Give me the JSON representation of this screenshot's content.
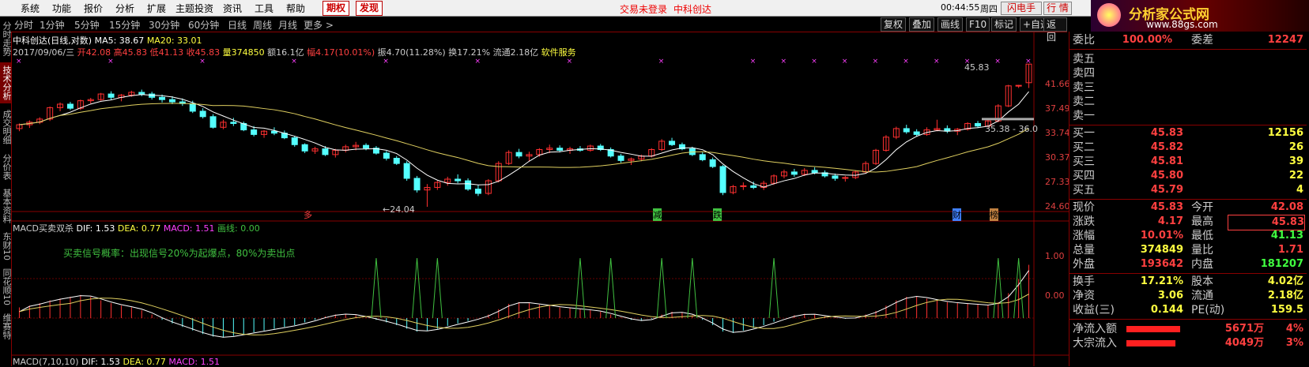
{
  "menu": [
    "系统",
    "功能",
    "报价",
    "分析",
    "扩展",
    "主题投资",
    "资讯",
    "工具",
    "帮助"
  ],
  "menu_red": [
    "期权",
    "发现"
  ],
  "status_login": "交易未登录",
  "status_stock": "中科创达",
  "clock": "00:44:55",
  "weekday": "周四",
  "btn_flash": "闪电手",
  "btn_quote": "行 情",
  "win_btns": [
    "-",
    "□",
    "×"
  ],
  "tabs": [
    "分时",
    "1分钟",
    "5分钟",
    "15分钟",
    "30分钟",
    "60分钟",
    "日线",
    "周线",
    "月线",
    "更多 >"
  ],
  "right_tabs": [
    "复权",
    "叠加",
    "画线",
    "F10",
    "标记",
    "+自选",
    "返回"
  ],
  "side_tabs": [
    "分时走势",
    "技术分析",
    "成交明细",
    "分价表",
    "基本资料",
    "东财10",
    "同花顺10",
    "维赛特"
  ],
  "logo": {
    "title": "分析家公式网",
    "url": "www.88gs.com"
  },
  "chart_info": {
    "name": "中科创达(日线,对数)",
    "ma5": "MA5: 38.67",
    "ma20": "MA20: 33.01"
  },
  "date_line": {
    "date": "2017/09/06/三",
    "open": "开42.08",
    "high": "高45.83",
    "low": "低41.13",
    "close": "收45.83",
    "vol": "量374850",
    "amt": "额16.1亿",
    "chg": "幅4.17(10.01%)",
    "amp": "振4.70(11.28%)",
    "turn": "换17.21%",
    "float": "流通2.18亿",
    "sector": "软件服务"
  },
  "macd_line": {
    "name": "MACD买卖双杀",
    "dif": "DIF: 1.53",
    "dea": "DEA: 0.77",
    "macd": "MACD: 1.51",
    "draw": "画线: 0.00"
  },
  "macd_note": "买卖信号概率：出现信号20%为起爆点，80%为卖出点",
  "macd2_line": {
    "name": "MACD(7,10,10)",
    "dif": "DIF: 1.53",
    "dea": "DEA: 0.77",
    "macd": "MACD: 1.51"
  },
  "price_labels": {
    "hi": "45.83",
    "lo": "←24.04",
    "mid": "35.38 - 36.0"
  },
  "markers": [
    "多",
    "减",
    "跌",
    "财",
    "榜"
  ],
  "y_ticks": [
    "41.66",
    "37.49",
    "33.74",
    "30.37",
    "27.33",
    "24.60"
  ],
  "macd_ticks": [
    "1.00",
    "0.00"
  ],
  "rp_top": {
    "label": "委比",
    "value": "100.00%",
    "label2": "委差",
    "value2": "12247"
  },
  "asks": [
    "卖五",
    "卖四",
    "卖三",
    "卖二",
    "卖一"
  ],
  "bids": [
    {
      "label": "买一",
      "price": "45.83",
      "vol": "12156"
    },
    {
      "label": "买二",
      "price": "45.82",
      "vol": "26"
    },
    {
      "label": "买三",
      "price": "45.81",
      "vol": "39"
    },
    {
      "label": "买四",
      "price": "45.80",
      "vol": "22"
    },
    {
      "label": "买五",
      "price": "45.79",
      "vol": "4"
    }
  ],
  "stats": [
    {
      "l": "现价",
      "v": "45.83",
      "l2": "今开",
      "v2": "42.08",
      "c": "#ff4040",
      "c2": "#ff4040"
    },
    {
      "l": "涨跌",
      "v": "4.17",
      "l2": "最高",
      "v2": "45.83",
      "c": "#ff4040",
      "c2": "#ff4040"
    },
    {
      "l": "涨幅",
      "v": "10.01%",
      "l2": "最低",
      "v2": "41.13",
      "c": "#ff4040",
      "c2": "#40ff40"
    },
    {
      "l": "总量",
      "v": "374849",
      "l2": "量比",
      "v2": "1.71",
      "c": "#ffff40",
      "c2": "#ff4040"
    },
    {
      "l": "外盘",
      "v": "193642",
      "l2": "内盘",
      "v2": "181207",
      "c": "#ff4040",
      "c2": "#40ff40"
    }
  ],
  "stats2": [
    {
      "l": "换手",
      "v": "17.21%",
      "l2": "股本",
      "v2": "4.02亿"
    },
    {
      "l": "净资",
      "v": "3.06",
      "l2": "流通",
      "v2": "2.18亿"
    },
    {
      "l": "收益(三)",
      "v": "0.144",
      "l2": "PE(动)",
      "v2": "159.5"
    }
  ],
  "flows": [
    {
      "l": "净流入额",
      "v": "5671万",
      "p": "4%"
    },
    {
      "l": "大宗流入",
      "v": "4049万",
      "p": "3%"
    }
  ],
  "colors": {
    "up": "#ff3030",
    "down": "#54ffff",
    "ma5": "#ffffff",
    "ma20": "#e0d060",
    "signal": "#40c040"
  },
  "chart_data": [
    {
      "type": "candlestick",
      "title": "中科创达(日线,对数)",
      "ohlc_approx": [
        [
          34.2,
          35.0,
          33.8,
          34.8
        ],
        [
          34.8,
          35.5,
          34.3,
          35.2
        ],
        [
          35.2,
          36.0,
          34.9,
          35.7
        ],
        [
          35.7,
          37.8,
          35.4,
          37.6
        ],
        [
          37.6,
          38.5,
          37.0,
          38.2
        ],
        [
          38.2,
          38.6,
          37.2,
          37.5
        ],
        [
          37.5,
          39.0,
          37.2,
          38.8
        ],
        [
          38.8,
          39.3,
          38.3,
          39.0
        ],
        [
          39.0,
          40.2,
          38.8,
          40.0
        ],
        [
          40.0,
          40.5,
          39.0,
          39.4
        ],
        [
          39.4,
          40.0,
          38.7,
          39.8
        ],
        [
          39.8,
          40.6,
          39.5,
          40.3
        ],
        [
          40.3,
          40.8,
          39.6,
          40.0
        ],
        [
          40.0,
          40.4,
          39.0,
          39.4
        ],
        [
          39.4,
          39.9,
          38.5,
          39.0
        ],
        [
          39.0,
          39.6,
          38.2,
          38.6
        ],
        [
          38.6,
          39.2,
          37.9,
          38.3
        ],
        [
          38.3,
          38.8,
          36.7,
          37.0
        ],
        [
          37.0,
          37.5,
          35.8,
          36.1
        ],
        [
          36.1,
          36.5,
          34.2,
          34.4
        ],
        [
          34.4,
          35.6,
          34.1,
          35.2
        ],
        [
          35.2,
          35.9,
          34.6,
          35.0
        ],
        [
          35.0,
          35.3,
          33.8,
          34.0
        ],
        [
          34.0,
          34.6,
          33.0,
          33.3
        ],
        [
          33.3,
          34.0,
          32.8,
          33.8
        ],
        [
          33.8,
          34.4,
          33.2,
          33.5
        ],
        [
          33.5,
          33.9,
          32.6,
          32.8
        ],
        [
          32.8,
          33.1,
          31.5,
          31.8
        ],
        [
          31.8,
          32.0,
          30.6,
          30.9
        ],
        [
          30.9,
          31.5,
          30.5,
          31.2
        ],
        [
          31.2,
          31.6,
          30.2,
          30.4
        ],
        [
          30.4,
          31.2,
          30.0,
          31.0
        ],
        [
          31.0,
          31.8,
          30.7,
          31.5
        ],
        [
          31.5,
          32.2,
          31.0,
          31.7
        ],
        [
          31.7,
          32.0,
          31.0,
          31.3
        ],
        [
          31.3,
          31.6,
          30.4,
          30.6
        ],
        [
          30.6,
          30.9,
          29.6,
          29.9
        ],
        [
          29.9,
          30.2,
          29.0,
          29.2
        ],
        [
          29.2,
          29.5,
          27.0,
          27.3
        ],
        [
          27.3,
          27.6,
          25.6,
          25.9
        ],
        [
          25.9,
          26.6,
          24.0,
          26.2
        ],
        [
          26.2,
          27.0,
          25.9,
          26.8
        ],
        [
          26.8,
          27.5,
          26.4,
          27.2
        ],
        [
          27.2,
          27.8,
          26.7,
          27.0
        ],
        [
          27.0,
          27.3,
          25.8,
          26.0
        ],
        [
          26.0,
          26.5,
          25.2,
          25.5
        ],
        [
          25.5,
          27.2,
          25.3,
          27.0
        ],
        [
          27.0,
          29.5,
          26.8,
          29.2
        ],
        [
          29.2,
          31.0,
          29.0,
          30.7
        ],
        [
          30.7,
          31.2,
          29.9,
          30.2
        ],
        [
          30.2,
          30.8,
          29.5,
          30.4
        ],
        [
          30.4,
          31.3,
          30.1,
          31.1
        ],
        [
          31.1,
          31.8,
          30.6,
          31.3
        ],
        [
          31.3,
          31.7,
          30.7,
          31.0
        ],
        [
          31.0,
          31.5,
          30.5,
          31.2
        ],
        [
          31.2,
          31.6,
          30.8,
          31.0
        ],
        [
          31.0,
          31.8,
          30.8,
          31.6
        ],
        [
          31.6,
          31.9,
          30.9,
          31.1
        ],
        [
          31.1,
          31.4,
          30.0,
          30.2
        ],
        [
          30.2,
          30.5,
          29.3,
          29.6
        ],
        [
          29.6,
          30.0,
          29.0,
          29.8
        ],
        [
          29.8,
          30.4,
          29.5,
          30.2
        ],
        [
          30.2,
          31.3,
          30.0,
          31.1
        ],
        [
          31.1,
          32.6,
          30.9,
          32.3
        ],
        [
          32.3,
          32.8,
          31.6,
          31.8
        ],
        [
          31.8,
          32.1,
          31.0,
          31.2
        ],
        [
          31.2,
          31.5,
          30.2,
          30.4
        ],
        [
          30.4,
          30.7,
          29.5,
          29.7
        ],
        [
          29.7,
          30.0,
          28.6,
          28.8
        ],
        [
          28.8,
          29.0,
          25.3,
          25.6
        ],
        [
          25.6,
          26.5,
          25.4,
          26.3
        ],
        [
          26.3,
          26.8,
          25.9,
          26.4
        ],
        [
          26.4,
          26.9,
          26.0,
          26.2
        ],
        [
          26.2,
          27.0,
          25.9,
          26.7
        ],
        [
          26.7,
          27.8,
          26.5,
          27.6
        ],
        [
          27.6,
          28.4,
          27.3,
          28.1
        ],
        [
          28.1,
          28.5,
          27.5,
          27.8
        ],
        [
          27.8,
          28.6,
          27.6,
          28.3
        ],
        [
          28.3,
          28.7,
          27.8,
          28.0
        ],
        [
          28.0,
          28.3,
          27.4,
          27.6
        ],
        [
          27.6,
          27.9,
          27.0,
          27.3
        ],
        [
          27.3,
          27.6,
          26.9,
          27.4
        ],
        [
          27.4,
          28.3,
          27.2,
          28.1
        ],
        [
          28.1,
          29.5,
          27.9,
          29.2
        ],
        [
          29.2,
          31.2,
          29.0,
          31.0
        ],
        [
          31.0,
          33.2,
          30.8,
          32.9
        ],
        [
          32.9,
          34.5,
          32.6,
          34.2
        ],
        [
          34.2,
          34.8,
          33.4,
          33.7
        ],
        [
          33.7,
          34.1,
          33.0,
          33.3
        ],
        [
          33.3,
          34.4,
          33.1,
          34.0
        ],
        [
          34.0,
          35.6,
          33.8,
          34.2
        ],
        [
          34.2,
          34.7,
          33.5,
          33.8
        ],
        [
          33.8,
          34.3,
          33.2,
          34.1
        ],
        [
          34.1,
          35.2,
          33.9,
          35.0
        ],
        [
          35.0,
          35.4,
          34.3,
          34.6
        ],
        [
          34.6,
          35.7,
          34.4,
          35.4
        ],
        [
          35.4,
          38.2,
          35.2,
          37.9
        ],
        [
          37.9,
          41.7,
          37.7,
          41.5
        ],
        [
          41.5,
          41.7,
          41.1,
          41.6
        ],
        [
          42.1,
          45.8,
          41.1,
          45.8
        ]
      ],
      "ma5": "MA5: 38.67",
      "ma20": "MA20: 33.01",
      "yticks": [
        41.66,
        37.49,
        33.74,
        30.37,
        27.33,
        24.6
      ],
      "high_label": 45.83,
      "low_label": 24.04,
      "markers": [
        "多",
        "减",
        "跌",
        "财",
        "榜"
      ]
    },
    {
      "type": "macd",
      "title": "MACD买卖双杀",
      "dif": 1.53,
      "dea": 0.77,
      "macd": 1.51,
      "yticks": [
        1.0,
        0.0
      ],
      "macd_bars_approx": [
        0.3,
        0.35,
        0.42,
        0.5,
        0.55,
        0.6,
        0.65,
        0.6,
        0.5,
        0.42,
        0.35,
        0.3,
        0.22,
        0.1,
        -0.05,
        -0.15,
        -0.25,
        -0.35,
        -0.45,
        -0.52,
        -0.55,
        -0.5,
        -0.45,
        -0.4,
        -0.35,
        -0.3,
        -0.25,
        -0.2,
        -0.12,
        -0.05,
        0.05,
        0.1,
        0.12,
        0.08,
        0.02,
        -0.05,
        -0.12,
        -0.2,
        -0.3,
        -0.38,
        -0.35,
        -0.3,
        -0.22,
        -0.15,
        -0.08,
        0.0,
        0.1,
        0.25,
        0.4,
        0.45,
        0.42,
        0.38,
        0.35,
        0.3,
        0.28,
        0.25,
        0.22,
        0.18,
        0.1,
        0.02,
        -0.05,
        -0.08,
        -0.02,
        0.1,
        0.18,
        0.15,
        0.08,
        -0.05,
        -0.2,
        -0.38,
        -0.42,
        -0.35,
        -0.28,
        -0.2,
        -0.1,
        0.0,
        0.08,
        0.12,
        0.1,
        0.05,
        0.02,
        -0.02,
        0.02,
        0.1,
        0.2,
        0.35,
        0.5,
        0.6,
        0.62,
        0.55,
        0.5,
        0.45,
        0.42,
        0.4,
        0.38,
        0.36,
        0.45,
        0.7,
        1.1,
        1.5
      ]
    }
  ]
}
